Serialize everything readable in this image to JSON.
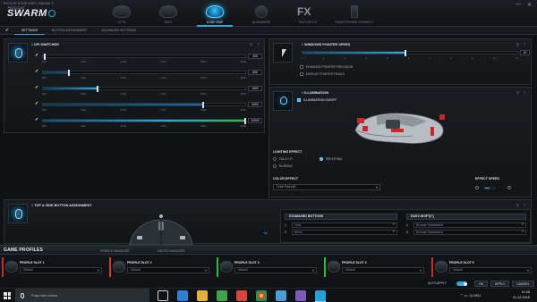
{
  "window": {
    "title": "ROCCAT KONE EMP | SWARM  ©",
    "logo_small": "ROCCAT",
    "logo": "SWARM",
    "min": "—",
    "close": "✕"
  },
  "nav": [
    {
      "label": "NYTH"
    },
    {
      "label": "KIRO"
    },
    {
      "label": "KONE EMP"
    },
    {
      "label": "ALIENWARE"
    },
    {
      "label": "ROCCAT FX"
    },
    {
      "label": "SMARTPHONE CONNECT"
    }
  ],
  "subtabs": [
    "✔",
    "SETTINGS",
    "BUTTON ASSIGNMENT",
    "ADVANCED SETTINGS"
  ],
  "dpi": {
    "title": "DPI SWITCHER",
    "ticks": [
      "850",
      "1800",
      "3000",
      "4750",
      "6500",
      "8000"
    ],
    "rows": [
      {
        "value": "400",
        "fill": 0.01,
        "color": "#1e4f70"
      },
      {
        "value": "800",
        "fill": 0.13,
        "color": "#1e4f70"
      },
      {
        "value": "1600",
        "fill": 0.27,
        "color": "#2fa6e0"
      },
      {
        "value": "6400",
        "fill": 0.79,
        "color": "#1c6aa0"
      },
      {
        "value": "12000",
        "fill": 1.0,
        "color": "#2fbb3e"
      }
    ]
  },
  "pointer": {
    "title": "WINDOWS POINTER SPEED",
    "value": "10",
    "fill": 0.48,
    "ticks": [
      "1",
      "2",
      "3",
      "4",
      "5",
      "6",
      "7",
      "8",
      "9",
      "10",
      "11"
    ],
    "opt1": "ENHANCE POINTER PRECISION",
    "opt2": "DISPLAY POINTER TRAILS"
  },
  "illumination": {
    "title": "ILLUMINATION",
    "on_off": "ILLUMINATION ON/OFF",
    "lighting_effect": "LIGHTING EFFECT",
    "fully_lit": "FULLY LIT",
    "breathing": "BREATHING",
    "blinking": "BLINKING",
    "color_effect": "COLOR EFFECT",
    "color_value": "Color Flow (all)",
    "effect_speed": "EFFECT SPEED",
    "accent": "#c8272b"
  },
  "buttons": {
    "title": "TOP & SIDE BUTTON ASSIGNMENT",
    "standard": "STANDARD BUTTONS",
    "easyshift": "EASY-SHIFT[+]",
    "std_rows": [
      {
        "n": "1",
        "v": "Click"
      },
      {
        "n": "2",
        "v": "Menu"
      }
    ],
    "es_rows": [
      {
        "n": "1",
        "v": "Browser Backwards"
      },
      {
        "n": "2",
        "v": "Browser Backwards"
      }
    ]
  },
  "profiles": {
    "title": "GAME PROFILES",
    "manager": "PROFILE MANAGER",
    "macro": "MACRO MANAGER",
    "slots": [
      {
        "name": "PROFILE SLOT 1",
        "value": "Default"
      },
      {
        "name": "PROFILE SLOT 2",
        "value": "Default"
      },
      {
        "name": "PROFILE SLOT 3",
        "value": "Default"
      },
      {
        "name": "PROFILE SLOT 4",
        "value": "Default"
      },
      {
        "name": "PROFILE SLOT 5",
        "value": "Default"
      }
    ]
  },
  "actions": {
    "auto_apply": "AUTO APPLY",
    "ok": "OK",
    "apply": "APPLY",
    "cancel": "CANCEL"
  },
  "taskbar": {
    "search": "Frag mich etwas",
    "lang": "DEU",
    "time": "11:46",
    "date": "21.12.2015"
  }
}
